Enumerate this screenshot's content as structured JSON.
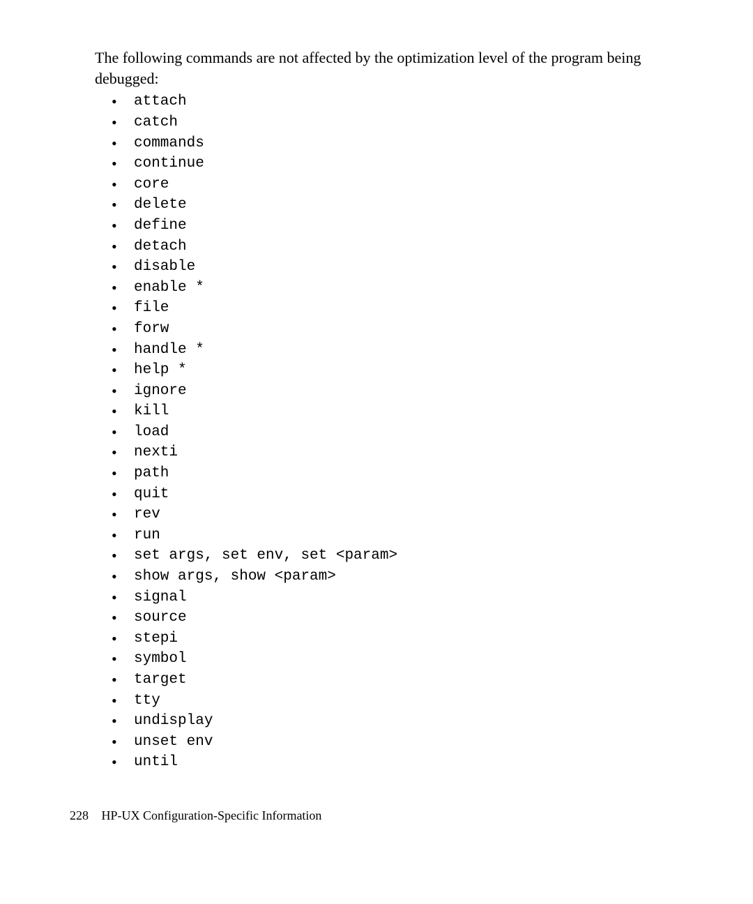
{
  "intro": "The following commands are not affected by the optimization level of the program being debugged:",
  "commands": [
    "attach",
    "catch",
    "commands",
    "continue",
    "core",
    "delete",
    "define",
    "detach",
    "disable",
    "enable *",
    "file",
    "forw",
    "handle *",
    "help *",
    "ignore",
    "kill",
    "load",
    "nexti",
    "path",
    "quit",
    "rev",
    "run",
    "set args, set env, set <param>",
    "show args, show <param>",
    "signal",
    "source",
    "stepi",
    "symbol",
    "target",
    "tty",
    "undisplay",
    "unset env",
    "until"
  ],
  "footer": {
    "page_number": "228",
    "section": "HP-UX Configuration-Specific Information"
  }
}
